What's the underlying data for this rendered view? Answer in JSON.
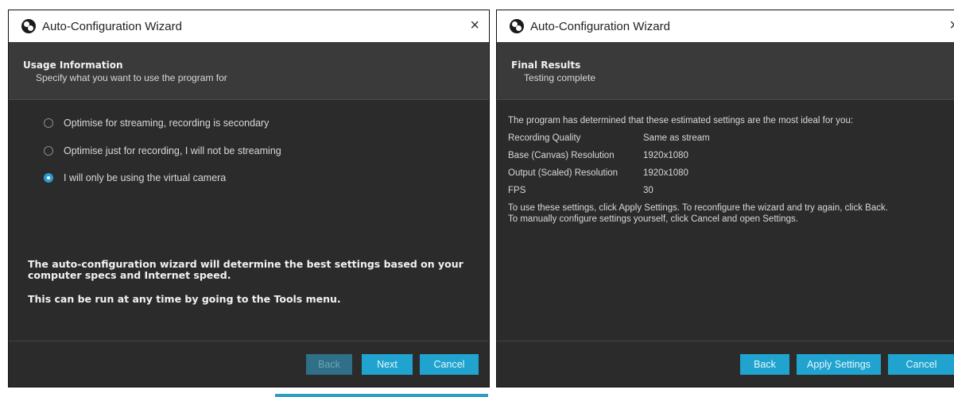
{
  "left_window": {
    "title": "Auto-Configuration Wizard",
    "close_glyph": "×",
    "header_title": "Usage Information",
    "header_subtitle": "Specify what you want to use the program for",
    "options": [
      {
        "label": "Optimise for streaming, recording is secondary",
        "selected": false
      },
      {
        "label": "Optimise just for recording, I will not be streaming",
        "selected": false
      },
      {
        "label": "I will only be using the virtual camera",
        "selected": true
      }
    ],
    "note_1": "The auto-configuration wizard will determine the best settings based on your computer specs and Internet speed.",
    "note_2": "This can be run at any time by going to the Tools menu.",
    "buttons": {
      "back": "Back",
      "next": "Next",
      "cancel": "Cancel"
    }
  },
  "right_window": {
    "title": "Auto-Configuration Wizard",
    "close_glyph": "×",
    "header_title": "Final Results",
    "header_subtitle": "Testing complete",
    "intro": "The program has determined that these estimated settings are the most ideal for you:",
    "results": [
      {
        "key": "Recording Quality",
        "value": "Same as stream"
      },
      {
        "key": "Base (Canvas) Resolution",
        "value": "1920x1080"
      },
      {
        "key": "Output (Scaled) Resolution",
        "value": "1920x1080"
      },
      {
        "key": "FPS",
        "value": "30"
      }
    ],
    "instructions_1": "To use these settings, click Apply Settings. To reconfigure the wizard and try again, click Back.",
    "instructions_2": "To manually configure settings yourself, click Cancel and open Settings.",
    "buttons": {
      "back": "Back",
      "apply": "Apply Settings",
      "cancel": "Cancel"
    }
  },
  "colors": {
    "accent": "#20a3cf",
    "window_bg": "#2b2b2b",
    "header_bg": "#3a3a3a"
  },
  "icons": {
    "app": "obs-logo-icon",
    "close": "close-icon"
  }
}
